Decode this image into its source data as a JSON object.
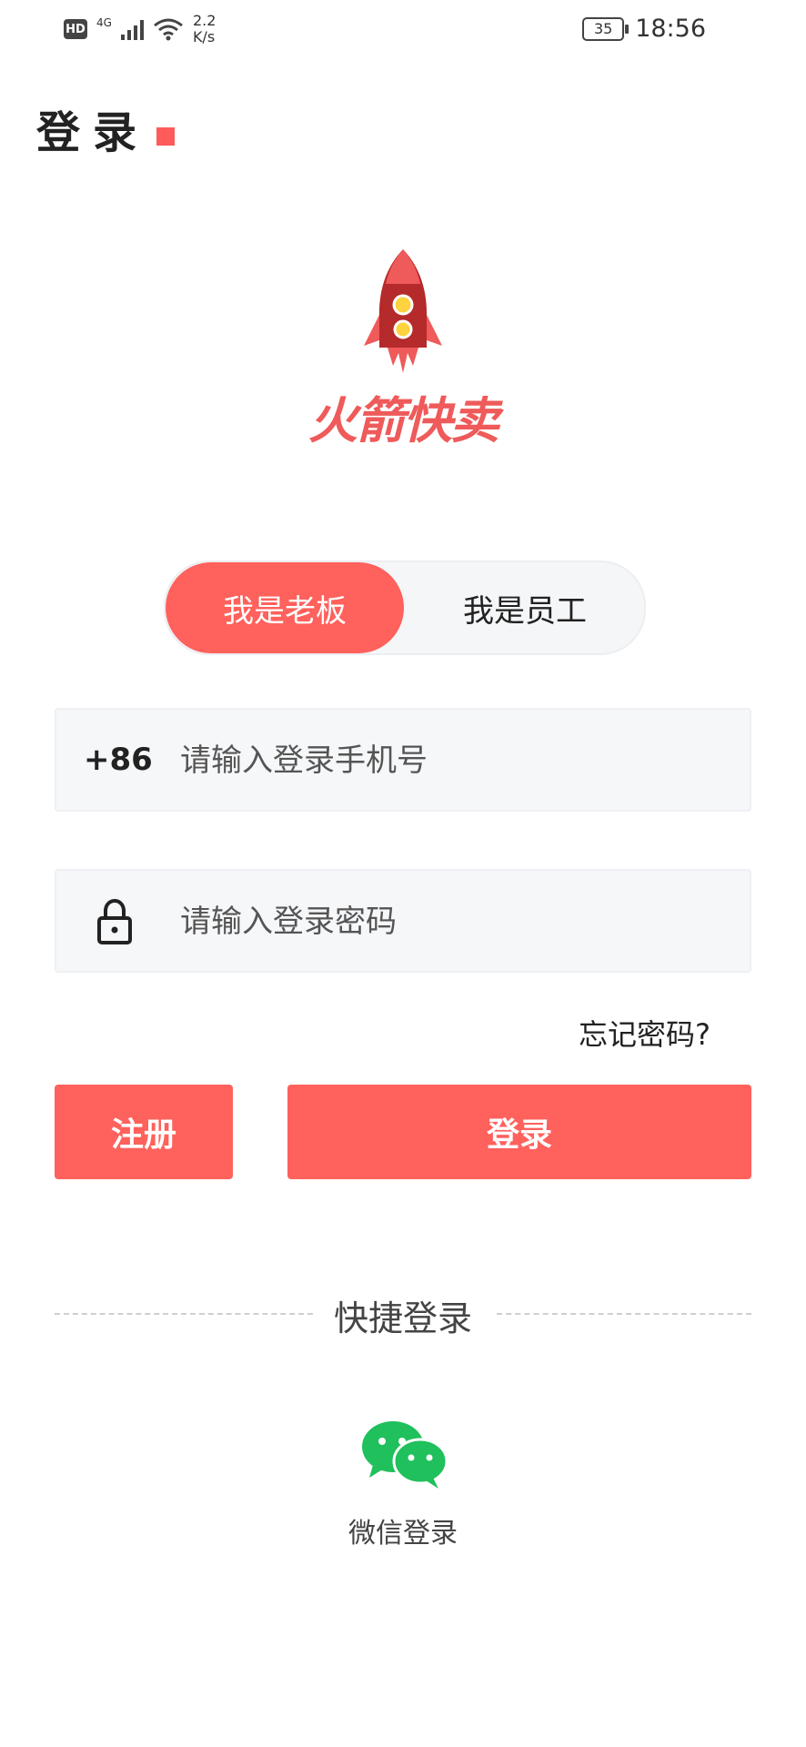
{
  "status_bar": {
    "hd": "HD",
    "network": "4G",
    "speed_value": "2.2",
    "speed_unit": "K/s",
    "battery": "35",
    "time": "18:56"
  },
  "header": {
    "title": "登录"
  },
  "logo": {
    "text": "火箭快卖",
    "colors": {
      "primary": "#ef5a5a",
      "dark": "#b52a2a",
      "window": "#ffd23f"
    }
  },
  "role_toggle": {
    "options": [
      "我是老板",
      "我是员工"
    ],
    "selected": "我是老板"
  },
  "phone_field": {
    "prefix": "+86",
    "placeholder": "请输入登录手机号",
    "value": ""
  },
  "password_field": {
    "icon": "lock-icon",
    "placeholder": "请输入登录密码",
    "value": ""
  },
  "forgot_link": "忘记密码?",
  "buttons": {
    "register": "注册",
    "login": "登录"
  },
  "quick_login": {
    "label": "快捷登录",
    "wechat_label": "微信登录",
    "wechat_icon": "wechat-icon"
  },
  "colors": {
    "accent": "#ff615c",
    "field_bg": "#f6f7f9",
    "wechat_green": "#20c05c"
  }
}
